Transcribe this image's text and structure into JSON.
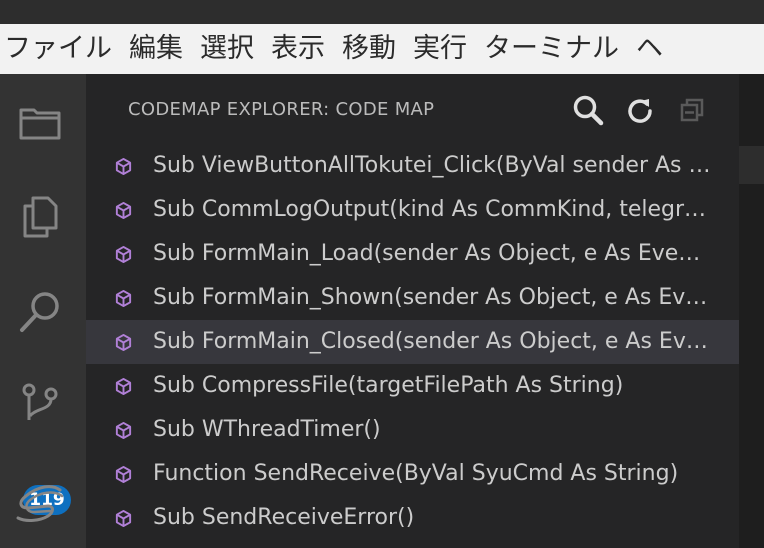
{
  "menubar": {
    "items": [
      "ファイル",
      "編集",
      "選択",
      "表示",
      "移動",
      "実行",
      "ターミナル",
      "ヘ"
    ]
  },
  "activitybar": {
    "icons": [
      "files-icon",
      "copy-icon",
      "search-icon",
      "source-control-icon",
      "codemap-icon"
    ],
    "scm_badge": "119"
  },
  "sidebar": {
    "title": "CODEMAP EXPLORER: CODE MAP",
    "actions": [
      "search-icon",
      "refresh-icon",
      "collapse-all-icon"
    ],
    "items": [
      {
        "label": "Sub ViewButtonAllTokutei_Click(ByVal sender As System.Object, ByVal e As System.EventArgs)",
        "selected": false
      },
      {
        "label": "Sub CommLogOutput(kind As CommKind, telegram As String)",
        "selected": false
      },
      {
        "label": "Sub FormMain_Load(sender As Object, e As EventArgs)",
        "selected": false
      },
      {
        "label": "Sub FormMain_Shown(sender As Object, e As EventArgs)",
        "selected": false
      },
      {
        "label": "Sub FormMain_Closed(sender As Object, e As EventArgs)",
        "selected": true
      },
      {
        "label": "Sub CompressFile(targetFilePath As String)",
        "selected": false
      },
      {
        "label": "Sub WThreadTimer()",
        "selected": false
      },
      {
        "label": "Function SendReceive(ByVal SyuCmd As String)",
        "selected": false
      },
      {
        "label": "Sub SendReceiveError()",
        "selected": false
      }
    ]
  },
  "colors": {
    "method_icon": "#b180d7",
    "badge": "#0e70c0",
    "selection": "#37373d"
  }
}
